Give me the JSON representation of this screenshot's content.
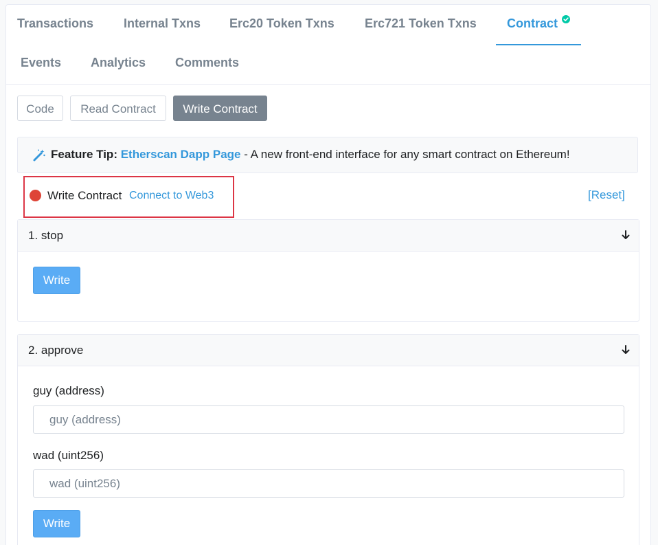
{
  "tabs": [
    {
      "label": "Transactions"
    },
    {
      "label": "Internal Txns"
    },
    {
      "label": "Erc20 Token Txns"
    },
    {
      "label": "Erc721 Token Txns"
    },
    {
      "label": "Contract",
      "active": true,
      "verified": true
    },
    {
      "label": "Events"
    },
    {
      "label": "Analytics"
    },
    {
      "label": "Comments"
    }
  ],
  "subtabs": [
    {
      "label": "Code"
    },
    {
      "label": "Read Contract"
    },
    {
      "label": "Write Contract",
      "active": true
    }
  ],
  "tip": {
    "icon": "magic-wand-icon",
    "prefix": "Feature Tip:",
    "link": "Etherscan Dapp Page",
    "text": " - A new front-end interface for any smart contract on Ethereum!"
  },
  "connect": {
    "status_color": "#de4437",
    "label": "Write Contract",
    "link": "Connect to Web3"
  },
  "reset_label": "[Reset]",
  "functions": [
    {
      "title": "1. stop",
      "write_label": "Write",
      "inputs": []
    },
    {
      "title": "2. approve",
      "write_label": "Write",
      "inputs": [
        {
          "label": "guy (address)",
          "placeholder": "guy (address)",
          "value": ""
        },
        {
          "label": "wad (uint256)",
          "placeholder": "wad (uint256)",
          "value": ""
        }
      ]
    }
  ],
  "colors": {
    "accent": "#3498db",
    "verified": "#00c9a7",
    "write_button": "#5aacf5",
    "highlight_border": "#dc3545"
  }
}
